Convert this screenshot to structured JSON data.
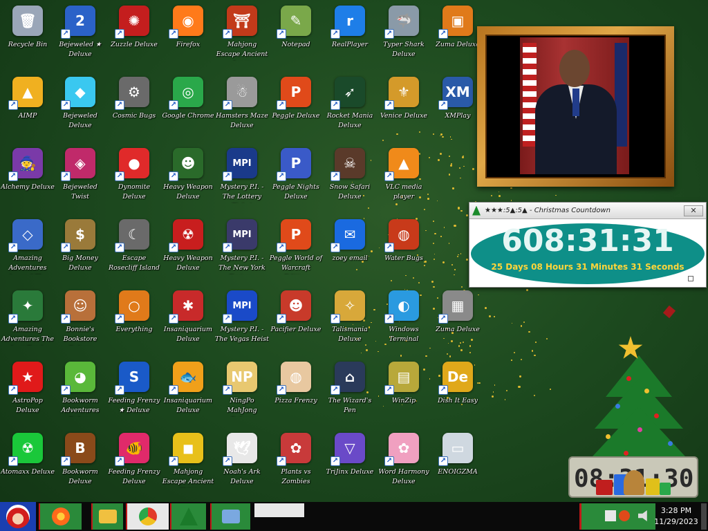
{
  "desktop": {
    "icons": [
      {
        "label": "Recycle Bin",
        "color": "#9aa6b8",
        "glyph": "🗑"
      },
      {
        "label": "Bejeweled ★ Deluxe",
        "color": "#2b62c8",
        "glyph": "2"
      },
      {
        "label": "Zuzzle Deluxe",
        "color": "#c41e1e",
        "glyph": "✺"
      },
      {
        "label": "Firefox",
        "color": "#ff7a1a",
        "glyph": "◉"
      },
      {
        "label": "Mahjong Escape Ancient Japan",
        "color": "#c23a1a",
        "glyph": "⛩"
      },
      {
        "label": "Notepad",
        "color": "#7aa84a",
        "glyph": "✎"
      },
      {
        "label": "RealPlayer",
        "color": "#1e7ee8",
        "glyph": "r"
      },
      {
        "label": "Typer Shark Deluxe",
        "color": "#8a9aa8",
        "glyph": "🦈"
      },
      {
        "label": "Zuma Deluxe",
        "color": "#e07a1a",
        "glyph": "▣"
      },
      {
        "label": "AIMP",
        "color": "#f0b020",
        "glyph": "▲"
      },
      {
        "label": "Bejeweled Deluxe",
        "color": "#3ac8f0",
        "glyph": "◆"
      },
      {
        "label": "Cosmic Bugs",
        "color": "#6a6a6a",
        "glyph": "⚙"
      },
      {
        "label": "Google Chrome",
        "color": "#2aa84a",
        "glyph": "◎"
      },
      {
        "label": "Hamsters Maze Deluxe",
        "color": "#9a9a9a",
        "glyph": "☃"
      },
      {
        "label": "Peggle Deluxe",
        "color": "#e04a1a",
        "glyph": "P"
      },
      {
        "label": "Rocket Mania Deluxe",
        "color": "#1a4a2a",
        "glyph": "➶"
      },
      {
        "label": "Venice Deluxe",
        "color": "#d49a2a",
        "glyph": "⚜"
      },
      {
        "label": "XMPlay",
        "color": "#2a5aa8",
        "glyph": "XM"
      },
      {
        "label": "Alchemy Deluxe",
        "color": "#7a3aa8",
        "glyph": "🧙"
      },
      {
        "label": "Bejeweled Twist",
        "color": "#c02a6a",
        "glyph": "◈"
      },
      {
        "label": "Dynomite Deluxe",
        "color": "#e02a2a",
        "glyph": "●"
      },
      {
        "label": "Heavy Weapon Deluxe",
        "color": "#2a6a2a",
        "glyph": "☻"
      },
      {
        "label": "Mystery P.I. - The Lottery Ticket",
        "color": "#1a3a8a",
        "glyph": "MPI"
      },
      {
        "label": "Peggle Nights Deluxe",
        "color": "#3a5ac8",
        "glyph": "P"
      },
      {
        "label": "Snow Safari Deluxe",
        "color": "#5a3a2a",
        "glyph": "☠"
      },
      {
        "label": "VLC media player",
        "color": "#f08a1a",
        "glyph": "▲"
      },
      {
        "label": "Big Money Deluxe",
        "color": "#9a7a3a",
        "glyph": "$"
      },
      {
        "label": "Escape Rosecliff Island",
        "color": "#6a6a6a",
        "glyph": "☾"
      },
      {
        "label": "Heavy Weapon Deluxe",
        "color": "#c81e1e",
        "glyph": "☢"
      },
      {
        "label": "Mystery P.I. - The New York Fortune",
        "color": "#3a3a6a",
        "glyph": "MPI"
      },
      {
        "label": "Peggle World of Warcraft Edition",
        "color": "#e04a1a",
        "glyph": "P"
      },
      {
        "label": "zoey email",
        "color": "#1a6ae0",
        "glyph": "✉"
      },
      {
        "label": "Water Bugs",
        "color": "#c83a1a",
        "glyph": "◍"
      },
      {
        "label": "Amazing Adventures Around The World",
        "color": "#3a6ac8",
        "glyph": "◇"
      },
      {
        "label": "Amazing Adventures The Lost Tomb",
        "color": "#2a7a3a",
        "glyph": "✦"
      },
      {
        "label": "Bonnie's Bookstore Deluxe",
        "color": "#b8703a",
        "glyph": "☺"
      },
      {
        "label": "Everything",
        "color": "#e07a1a",
        "glyph": "○"
      },
      {
        "label": "Insaniquarium Deluxe",
        "color": "#c82a2a",
        "glyph": "✱"
      },
      {
        "label": "Mystery P.I. - The Vegas Heist",
        "color": "#1a4ac8",
        "glyph": "MPI"
      },
      {
        "label": "Pacifier Deluxe",
        "color": "#c83a2a",
        "glyph": "☻"
      },
      {
        "label": "Talismania Deluxe",
        "color": "#d8a83a",
        "glyph": "✧"
      },
      {
        "label": "Windows Terminal",
        "color": "#2a9ae0",
        "glyph": "◐"
      },
      {
        "label": "Zuma Deluxe",
        "color": "#8a8a8a",
        "glyph": "▦"
      },
      {
        "label": "AstroPop Deluxe",
        "color": "#e01a1a",
        "glyph": "★"
      },
      {
        "label": "Bookworm Adventures Deluxe",
        "color": "#5ab83a",
        "glyph": "◕"
      },
      {
        "label": "Feeding Frenzy ★ Deluxe",
        "color": "#1a5ac8",
        "glyph": "S"
      },
      {
        "label": "Insaniquarium Deluxe",
        "color": "#f0a01a",
        "glyph": "🐟"
      },
      {
        "label": "NingPo MahJong Deluxe",
        "color": "#e8c870",
        "glyph": "NP"
      },
      {
        "label": "Pizza Frenzy",
        "color": "#e8c8a0",
        "glyph": "◍"
      },
      {
        "label": "The Wizard's Pen",
        "color": "#2a3a5a",
        "glyph": "⌂"
      },
      {
        "label": "WinZip",
        "color": "#b8a83a",
        "glyph": "▤"
      },
      {
        "label": "Dish It Easy",
        "color": "#e0a81a",
        "glyph": "De"
      },
      {
        "label": "Atomaxx Deluxe",
        "color": "#1ac83a",
        "glyph": "☢"
      },
      {
        "label": "Bookworm Deluxe",
        "color": "#8a4a1a",
        "glyph": "B"
      },
      {
        "label": "Feeding Frenzy Deluxe",
        "color": "#e02a6a",
        "glyph": "🐠"
      },
      {
        "label": "Mahjong Escape Ancient China",
        "color": "#e8c01a",
        "glyph": "◼"
      },
      {
        "label": "Noah's Ark Deluxe",
        "color": "#e8e8e8",
        "glyph": "🕊"
      },
      {
        "label": "Plants vs Zombies",
        "color": "#c83a3a",
        "glyph": "✿"
      },
      {
        "label": "TriJinx Deluxe",
        "color": "#6a4ac8",
        "glyph": "▽"
      },
      {
        "label": "Word Harmony Deluxe",
        "color": "#f0a0c0",
        "glyph": "✿"
      },
      {
        "label": "ENOIGZMA",
        "color": "#cfd8e0",
        "glyph": "▭"
      }
    ]
  },
  "frame": {
    "label": "presidential-portrait"
  },
  "countdown": {
    "title": "★★★:5▲:5▲ - Christmas Countdown",
    "close_label": "✕",
    "big_time": "608:31:31",
    "detail": "25 Days 08 Hours 31 Minutes 31 Seconds"
  },
  "clock_widget": {
    "digits": "08:31:30"
  },
  "taskbar": {
    "time": "3:28 PM",
    "date": "11/29/2023"
  }
}
